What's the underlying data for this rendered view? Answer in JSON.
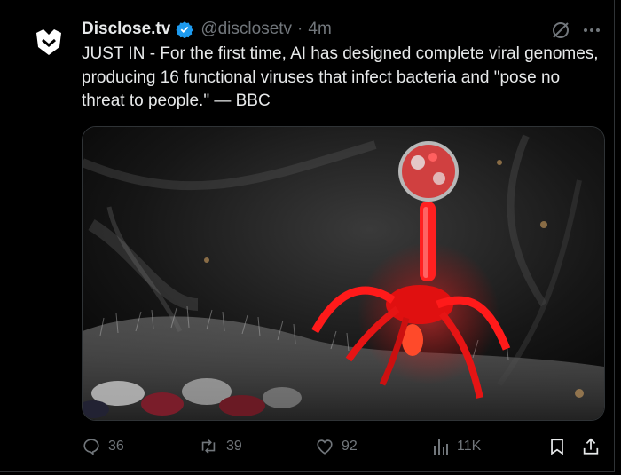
{
  "tweet": {
    "display_name": "Disclose.tv",
    "handle": "@disclosetv",
    "separator": "·",
    "time": "4m",
    "text": "JUST IN - For the first time, AI has designed complete viral genomes, producing 16 functional viruses that infect bacteria and \"pose no threat to people.\" — BBC"
  },
  "actions": {
    "replies": "36",
    "reposts": "39",
    "likes": "92",
    "views": "11K"
  },
  "icons": {
    "verified": "verified-badge-icon",
    "grok": "grok-icon",
    "more": "more-icon",
    "reply": "reply-icon",
    "repost": "repost-icon",
    "like": "like-icon",
    "views": "views-icon",
    "bookmark": "bookmark-icon",
    "share": "share-icon"
  },
  "colors": {
    "background": "#000000",
    "text": "#e7e9ea",
    "muted": "#71767b",
    "verified": "#1d9bf0",
    "phage": "#ff1a1a"
  }
}
